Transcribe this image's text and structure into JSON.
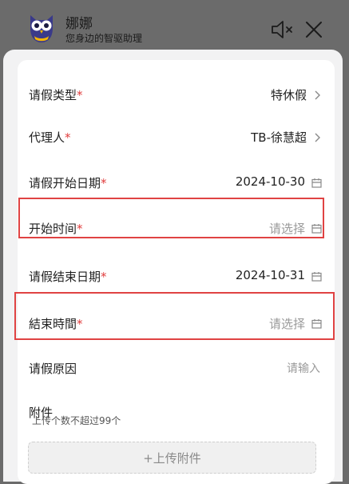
{
  "header": {
    "title": "娜娜",
    "subtitle": "您身边的智驱助理"
  },
  "form": {
    "leave_type": {
      "label": "请假类型",
      "value": "特休假"
    },
    "delegate": {
      "label": "代理人",
      "value": "TB-徐慧超"
    },
    "start_date": {
      "label": "请假开始日期",
      "value": "2024-10-30"
    },
    "start_time": {
      "label": "开始时间",
      "placeholder": "请选择"
    },
    "end_date": {
      "label": "请假结束日期",
      "value": "2024-10-31"
    },
    "end_time": {
      "label": "結束時間",
      "placeholder": "请选择"
    },
    "reason": {
      "label": "请假原因",
      "placeholder": "请输入"
    },
    "attachment": {
      "label": "附件",
      "hint": "上传个数不超过99个",
      "button": "+上传附件"
    },
    "required_mark": "*"
  },
  "colors": {
    "required": "#e03c3c",
    "highlight": "#e04343",
    "overlay": "#6b6b6b"
  }
}
